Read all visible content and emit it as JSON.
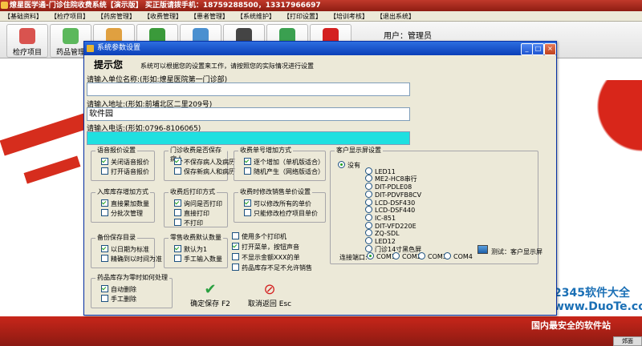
{
  "app": {
    "title": "燎星医学通-门诊住院收费系统【演示版】 买正版请拨手机：18759288500，13317966697",
    "menu": [
      "【基础资料】",
      "【检疗项目】",
      "【药房管理】",
      "【收费管理】",
      "【患者管理】",
      "【系统维护】",
      "【打印设置】",
      "【培训考核】",
      "【退出系统】"
    ],
    "toolbar": [
      {
        "label": "检疗项目",
        "icon": "house-icon",
        "color": "#d9534f"
      },
      {
        "label": "药品管理",
        "icon": "pill-icon",
        "color": "#5cb85c"
      },
      {
        "label": "",
        "icon": "people-icon",
        "color": "#e0a040"
      },
      {
        "label": "",
        "icon": "flag-icon",
        "color": "#3a9a3a"
      },
      {
        "label": "",
        "icon": "doctor-icon",
        "color": "#4a90d0"
      },
      {
        "label": "",
        "icon": "register-icon",
        "color": "#444444"
      },
      {
        "label": "",
        "icon": "chart-icon",
        "color": "#3aa050"
      },
      {
        "label": "",
        "icon": "stop-icon",
        "color": "#d42020"
      }
    ],
    "user_label": "用户：管理员",
    "watermark": "2345软件大全 www.DuoTe.com",
    "tagline": "国内最安全的软件站",
    "status_tab": "郊面"
  },
  "dialog": {
    "title": "系统参数设置",
    "tip_title": "提示您",
    "tip_text": "系统可以根据您的设置来工作，请按照您的实际情况进行设置",
    "unit_label": "请输入单位名称:(形如:燎星医院第一门诊部)",
    "unit_value": "",
    "addr_label": "请输入地址:(形如:前埔北区二里209号)",
    "addr_value": "软件园",
    "phone_label": "请输入电话:(形如:0796-8106065)",
    "phone_value": "",
    "groups": {
      "voice": {
        "title": "语音报价设置",
        "opts": [
          {
            "t": "关闭语音报价",
            "on": true
          },
          {
            "t": "打开语音报价",
            "on": false
          }
        ]
      },
      "save_patient": {
        "title": "门诊收费是否保存病人",
        "opts": [
          {
            "t": "不保存病人及病历",
            "on": true
          },
          {
            "t": "保存新病人和病历",
            "on": false
          }
        ]
      },
      "bill_no": {
        "title": "收费单号增加方式",
        "opts": [
          {
            "t": "逐个增加（单机版适合）",
            "on": true
          },
          {
            "t": "随机产生（网络版适合）",
            "on": false
          }
        ]
      },
      "stock_in": {
        "title": "入库库存增加方式",
        "opts": [
          {
            "t": "直接累加数量",
            "on": true
          },
          {
            "t": "分批次管理",
            "on": false
          }
        ]
      },
      "print_after": {
        "title": "收费后打印方式",
        "opts": [
          {
            "t": "询问是否打印",
            "on": true
          },
          {
            "t": "直接打印",
            "on": false
          },
          {
            "t": "不打印",
            "on": false
          }
        ]
      },
      "modify_price": {
        "title": "收费时修改销售单价设置",
        "opts": [
          {
            "t": "可以修改所有的单价",
            "on": true
          },
          {
            "t": "只能修改检疗项目单价",
            "on": false
          }
        ]
      },
      "backup": {
        "title": "备份保存目录",
        "opts": [
          {
            "t": "以日期为标准",
            "on": true
          },
          {
            "t": "精确到以时间为准",
            "on": false
          }
        ]
      },
      "retail_qty": {
        "title": "零售收费默认数量",
        "opts": [
          {
            "t": "默认为1",
            "on": true
          },
          {
            "t": "手工输入数量",
            "on": false
          }
        ]
      },
      "drug_zero": {
        "title": "药品库存为零时如何处理",
        "opts": [
          {
            "t": "自动删除",
            "on": true
          },
          {
            "t": "手工删除",
            "on": false
          }
        ]
      }
    },
    "misc_opts": [
      {
        "t": "使用多个打印机",
        "on": false
      },
      {
        "t": "打开菜单，按钮声音",
        "on": true
      },
      {
        "t": "不显示金额XXX的单",
        "on": false
      },
      {
        "t": "药品库存不足不允许销售",
        "on": false
      }
    ],
    "display": {
      "title": "客户显示屏设置",
      "devices": [
        {
          "t": "没有",
          "on": true
        },
        {
          "t": "LED11",
          "on": false
        },
        {
          "t": "ME2-HC8串行",
          "on": false
        },
        {
          "t": "DIT-PDLE08",
          "on": false
        },
        {
          "t": "DIT-PDVFB8CV",
          "on": false
        },
        {
          "t": "LCD-DSF430",
          "on": false
        },
        {
          "t": "LCD-DSF440",
          "on": false
        },
        {
          "t": "IC-851",
          "on": false
        },
        {
          "t": "DIT-VFD220E",
          "on": false
        },
        {
          "t": "ZQ-SDL",
          "on": false
        },
        {
          "t": "LED12",
          "on": false
        },
        {
          "t": "门诊14寸黑色屏",
          "on": false
        }
      ],
      "port_label": "连接端口:",
      "ports": [
        {
          "t": "COM1",
          "on": true
        },
        {
          "t": "COM2",
          "on": false
        },
        {
          "t": "COM3",
          "on": false
        },
        {
          "t": "COM4",
          "on": false
        }
      ],
      "test_label": "测试：客户显示屏"
    },
    "ok_label": "确定保存 F2",
    "cancel_label": "取消返回 Esc"
  }
}
